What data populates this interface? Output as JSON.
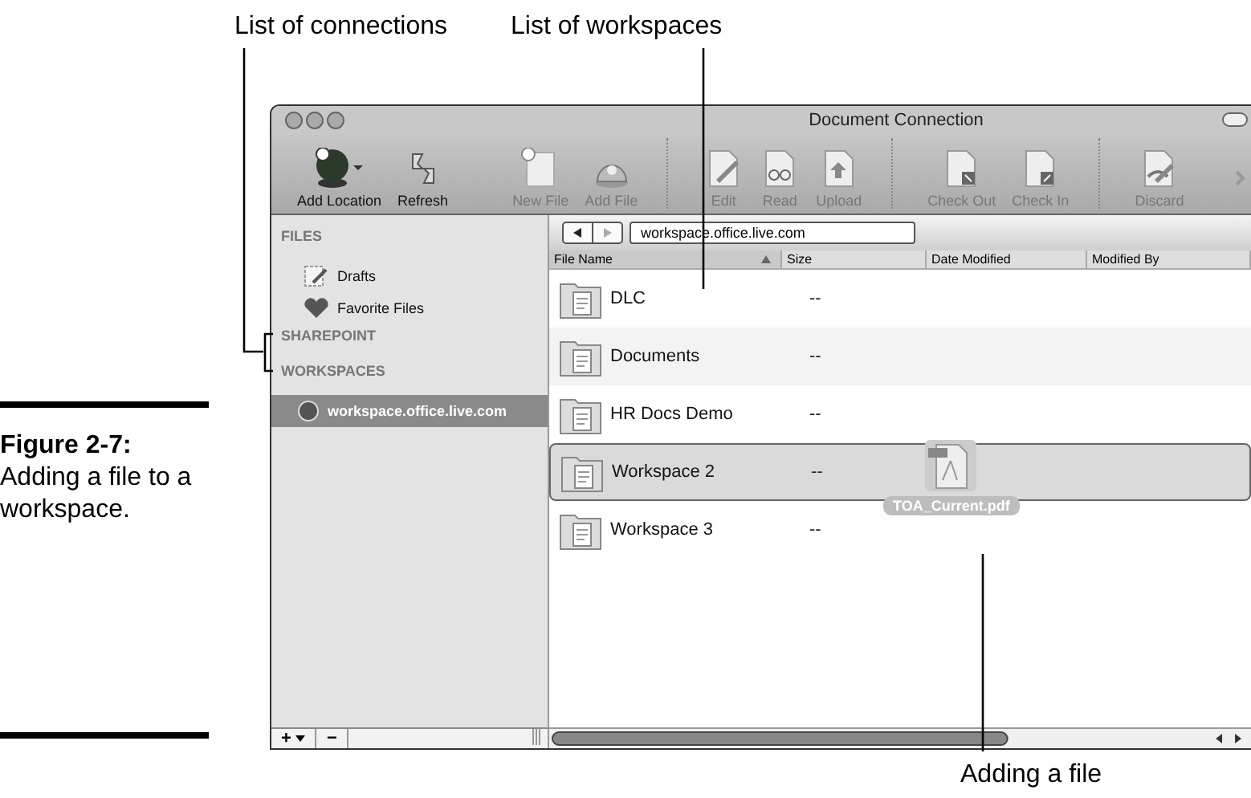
{
  "annotations": [
    {
      "label": "List of connections"
    },
    {
      "label": "List of workspaces"
    },
    {
      "label": "Adding a file"
    }
  ],
  "caption": "**Figure 2-7:** Adding a file to a workspace.",
  "window": {
    "title": "Document Connection"
  },
  "toolbar": [
    {
      "items": [
        {
          "label": "Add Location",
          "disabled": false
        },
        {
          "label": "Refresh",
          "disabled": false
        }
      ]
    },
    {
      "items": [
        {
          "label": "New File",
          "disabled": true
        },
        {
          "label": "Add File",
          "disabled": true
        }
      ]
    },
    {
      "items": [
        {
          "label": "Edit",
          "disabled": true
        },
        {
          "label": "Read",
          "disabled": true
        },
        {
          "label": "Upload",
          "disabled": true
        }
      ]
    },
    {
      "items": [
        {
          "label": "Check Out",
          "disabled": true
        },
        {
          "label": "Check In",
          "disabled": true
        }
      ]
    },
    {
      "items": [
        {
          "label": "Discard",
          "disabled": true
        }
      ]
    }
  ],
  "sidebar": {
    "sections": [
      {
        "heading": "FILES",
        "items": [
          {
            "label": "Drafts",
            "selected": false
          },
          {
            "label": "Favorite Files",
            "selected": false
          }
        ]
      },
      {
        "heading": "SHAREPOINT"
      },
      {
        "heading": "WORKSPACES",
        "items": [
          {
            "label": "workspace.office.live.com",
            "selected": true
          }
        ]
      }
    ],
    "footer": [
      "+",
      "−"
    ]
  },
  "location": "workspace.office.live.com",
  "table": {
    "columns": [
      "File Name",
      "Size",
      "Date Modified",
      "Modified By"
    ],
    "rows": [
      {
        "name": "DLC",
        "size": "--",
        "selected": false
      },
      {
        "name": "Documents",
        "size": "--",
        "selected": false
      },
      {
        "name": "HR Docs Demo",
        "size": "--",
        "selected": false
      },
      {
        "name": "Workspace 2",
        "size": "--",
        "selected": true
      },
      {
        "name": "Workspace 3",
        "size": "--",
        "selected": false
      }
    ]
  },
  "drag_item": {
    "label": "TOA_Current.pdf"
  }
}
